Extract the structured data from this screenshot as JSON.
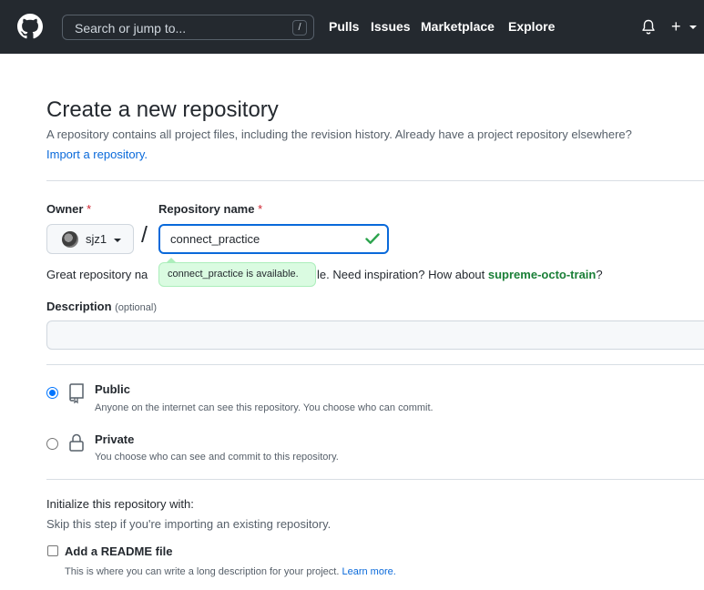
{
  "header": {
    "search_placeholder": "Search or jump to...",
    "search_shortcut": "/",
    "nav": [
      "Pulls",
      "Issues",
      "Marketplace",
      "Explore"
    ],
    "plus_label": "+"
  },
  "page": {
    "title": "Create a new repository",
    "description": "A repository contains all project files, including the revision history. Already have a project repository elsewhere?",
    "import_link": "Import a repository."
  },
  "owner": {
    "label": "Owner",
    "required_mark": "*",
    "value": "sjz1"
  },
  "repo_name": {
    "label": "Repository name",
    "required_mark": "*",
    "value": "connect_practice",
    "separator": "/"
  },
  "availability": {
    "hint_start": "Great repository na",
    "hint_end": "le. Need inspiration? How about ",
    "suggestion": "supreme-octo-train",
    "hint_tail": "?",
    "tooltip": "connect_practice is available."
  },
  "description_field": {
    "label": "Description",
    "optional": "(optional)",
    "value": ""
  },
  "visibility": {
    "selected": "Public",
    "options": [
      {
        "title": "Public",
        "desc": "Anyone on the internet can see this repository. You choose who can commit."
      },
      {
        "title": "Private",
        "desc": "You choose who can see and commit to this repository."
      }
    ]
  },
  "initialize": {
    "title": "Initialize this repository with:",
    "subtitle": "Skip this step if you're importing an existing repository.",
    "readme_label": "Add a README file",
    "readme_desc": "This is where you can write a long description for your project.",
    "learn_more": "Learn more.",
    "readme_checked": false
  },
  "colors": {
    "header_bg": "#24292f",
    "link": "#0969da",
    "success": "#1a7f37",
    "required": "#cf222e",
    "tooltip_bg": "#dafbe1"
  }
}
